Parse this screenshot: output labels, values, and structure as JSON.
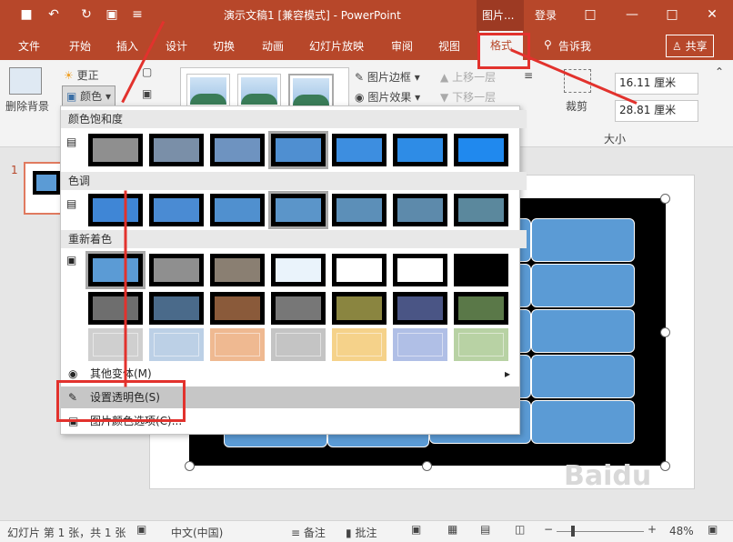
{
  "title_bar": {
    "title": "演示文稿1 [兼容模式] - PowerPoint",
    "context_tab": "图片...",
    "login": "登录"
  },
  "ribbon_tabs": [
    "文件",
    "开始",
    "插入",
    "设计",
    "切换",
    "动画",
    "幻灯片放映",
    "审阅",
    "视图",
    "格式"
  ],
  "tell_me": "告诉我",
  "share": "共享",
  "ribbon": {
    "remove_bg": "删除背景",
    "corrections": "更正",
    "color": "颜色",
    "picture_border": "图片边框",
    "picture_effects": "图片效果",
    "bring_forward": "上移一层",
    "send_backward": "下移一层",
    "crop": "裁剪",
    "height": "16.11 厘米",
    "width": "28.81 厘米",
    "size_group": "大小"
  },
  "dropdown": {
    "saturation_header": "颜色饱和度",
    "tone_header": "色调",
    "recolor_header": "重新着色",
    "more_variations": "其他变体(M)",
    "set_transparent": "设置透明色(S)",
    "color_options": "图片颜色选项(C)..."
  },
  "slide_number": "1",
  "status": {
    "slide_info": "幻灯片 第 1 张，共 1 张",
    "language": "中文(中国)",
    "notes": "备注",
    "comments": "批注",
    "zoom": "48%"
  },
  "colors": {
    "accent": "#b7472a",
    "highlight_red": "#e2322d",
    "cell_blue": "#5b9bd5"
  },
  "swatches": {
    "saturation": [
      "#8f8f8f",
      "#7a8fa8",
      "#6e93c0",
      "#4f8fd1",
      "#3d8ee0",
      "#2e8ce6",
      "#2089ee"
    ],
    "tone": [
      "#3f86d6",
      "#4a8bd3",
      "#5090cf",
      "#5b95c9",
      "#5c8fb8",
      "#5d8aab",
      "#5b889d"
    ],
    "recolor_row1": [
      "#5b9bd5",
      "#8f8f8f",
      "#8a7f72",
      "#eaf3fb",
      "#ffffff",
      "#ffffff",
      "#000000"
    ],
    "recolor_row2": [
      "#6e6e6e",
      "#4a6a8a",
      "#8a5a3a",
      "#777777",
      "#8a8540",
      "#4a5585",
      "#5a7848"
    ],
    "recolor_row3": [
      "#cfcfcf",
      "#bcd0e6",
      "#efb991",
      "#c4c4c4",
      "#f5d28a",
      "#b0bfe6",
      "#b8d2a4"
    ]
  }
}
